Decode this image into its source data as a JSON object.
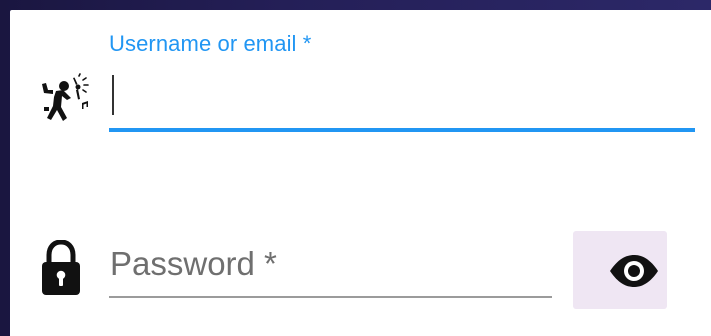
{
  "form": {
    "username": {
      "label": "Username or email *",
      "value": "",
      "icon": "singer-icon"
    },
    "password": {
      "placeholder": "Password *",
      "value": "",
      "icon": "lock-icon",
      "toggle_icon": "eye-icon"
    }
  },
  "colors": {
    "accent": "#2196f3",
    "background": "#262259",
    "toggle_button": "#efe6f3"
  }
}
